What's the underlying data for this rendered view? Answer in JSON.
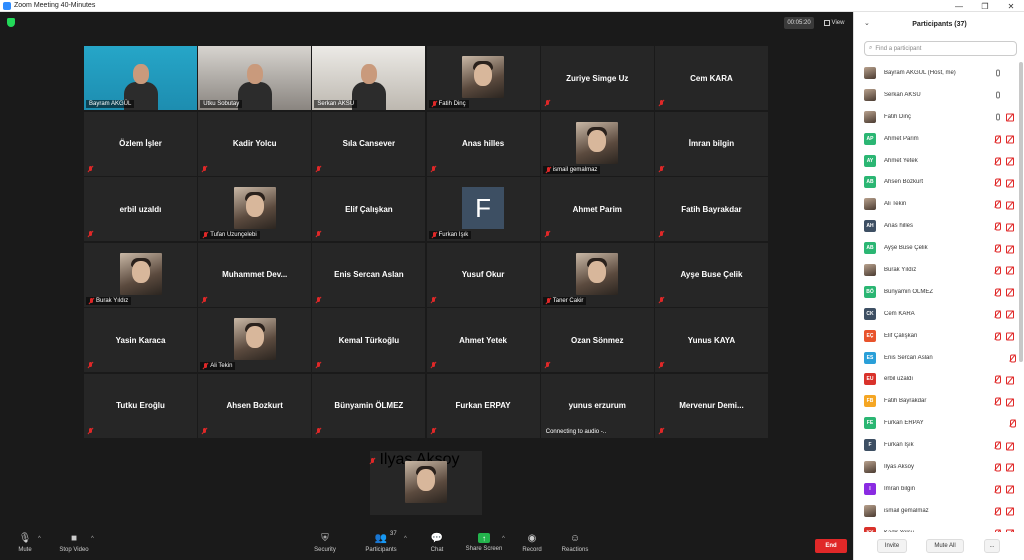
{
  "window": {
    "title": "Zoom Meeting 40-Minutes"
  },
  "meeting": {
    "timer": "00:05:20",
    "view_label": "View"
  },
  "tiles": [
    {
      "name": "Bayram AKGÜL",
      "kind": "video",
      "cam": "cam1",
      "active": true
    },
    {
      "name": "Utku Sobutay",
      "kind": "video",
      "cam": "cam2"
    },
    {
      "name": "Serkan AKSU",
      "kind": "video",
      "cam": "cam3"
    },
    {
      "name": "Fatih Dinç",
      "kind": "photo"
    },
    {
      "name": "Zuriye Simge Uz",
      "kind": "text"
    },
    {
      "name": "Cem KARA",
      "kind": "text"
    },
    {
      "name": "Özlem İşler",
      "kind": "text"
    },
    {
      "name": "Kadir Yolcu",
      "kind": "text"
    },
    {
      "name": "Sıla Cansever",
      "kind": "text"
    },
    {
      "name": "Anas hilles",
      "kind": "text"
    },
    {
      "name": "ismail gemalmaz",
      "kind": "photo"
    },
    {
      "name": "İmran bilgin",
      "kind": "text"
    },
    {
      "name": "erbil uzaldı",
      "kind": "text"
    },
    {
      "name": "Tufan Uzunçelebi",
      "kind": "photo"
    },
    {
      "name": "Elif Çalışkan",
      "kind": "text"
    },
    {
      "name": "Furkan Işık",
      "kind": "letter",
      "letter": "F"
    },
    {
      "name": "Ahmet Parim",
      "kind": "text"
    },
    {
      "name": "Fatih Bayrakdar",
      "kind": "text"
    },
    {
      "name": "Burak Yıldız",
      "kind": "photo"
    },
    {
      "name": "Muhammet  Dev...",
      "kind": "text"
    },
    {
      "name": "Enis Sercan Aslan",
      "kind": "text"
    },
    {
      "name": "Yusuf Okur",
      "kind": "text"
    },
    {
      "name": "Taner Cakir",
      "kind": "photo"
    },
    {
      "name": "Ayşe Buse Çelik",
      "kind": "text"
    },
    {
      "name": "Yasin Karaca",
      "kind": "text"
    },
    {
      "name": "Ali Tekin",
      "kind": "photo"
    },
    {
      "name": "Kemal Türkoğlu",
      "kind": "text"
    },
    {
      "name": "Ahmet Yetek",
      "kind": "text"
    },
    {
      "name": "Ozan Sönmez",
      "kind": "text"
    },
    {
      "name": "Yunus KAYA",
      "kind": "text"
    },
    {
      "name": "Tutku Eroğlu",
      "kind": "text"
    },
    {
      "name": "Ahsen Bozkurt",
      "kind": "text"
    },
    {
      "name": "Bünyamin ÖLMEZ",
      "kind": "text"
    },
    {
      "name": "Furkan ERPAY",
      "kind": "text"
    },
    {
      "name": "yunus erzurum",
      "kind": "text",
      "status": "Connecting to audio -.."
    },
    {
      "name": "Mervenur  Demi...",
      "kind": "text"
    }
  ],
  "solo_tile": {
    "name": "Ilyas Aksoy",
    "kind": "photo"
  },
  "toolbar": {
    "mute": "Mute",
    "stop_video": "Stop Video",
    "security": "Security",
    "participants": "Participants",
    "participants_count": "37",
    "chat": "Chat",
    "share_screen": "Share Screen",
    "record": "Record",
    "reactions": "Reactions",
    "end": "End"
  },
  "panel": {
    "title": "Participants (37)",
    "search_placeholder": "Find a participant",
    "invite": "Invite",
    "mute_all": "Mute All",
    "more": "...",
    "participants": [
      {
        "name": "Bayram AKGÜL (Host, me)",
        "avatar": "photo",
        "mic": "on",
        "cam": "on"
      },
      {
        "name": "Serkan AKSU",
        "avatar": "photo",
        "mic": "on",
        "cam": "on"
      },
      {
        "name": "Fatih Dinç",
        "avatar": "photo",
        "mic": "on",
        "cam": "off"
      },
      {
        "name": "Ahmet Parim",
        "initials": "AP",
        "color": "#2bb673",
        "mic": "off",
        "cam": "off"
      },
      {
        "name": "Ahmet Yetek",
        "initials": "AY",
        "color": "#2bb673",
        "mic": "off",
        "cam": "off"
      },
      {
        "name": "Ahsen Bozkurt",
        "initials": "AB",
        "color": "#2bb673",
        "mic": "off",
        "cam": "off"
      },
      {
        "name": "Ali Tekin",
        "avatar": "photo",
        "mic": "off",
        "cam": "off"
      },
      {
        "name": "Anas hilles",
        "initials": "AH",
        "color": "#3d4f63",
        "mic": "off",
        "cam": "off"
      },
      {
        "name": "Ayşe Buse Çelik",
        "initials": "AB",
        "color": "#2bb673",
        "mic": "off",
        "cam": "off"
      },
      {
        "name": "Burak Yıldız",
        "avatar": "photo",
        "mic": "off",
        "cam": "off"
      },
      {
        "name": "Bünyamin ÖLMEZ",
        "initials": "BÖ",
        "color": "#2bb673",
        "mic": "off",
        "cam": "off"
      },
      {
        "name": "Cem KARA",
        "initials": "CK",
        "color": "#3d4f63",
        "mic": "off",
        "cam": "off"
      },
      {
        "name": "Elif Çalışkan",
        "initials": "EÇ",
        "color": "#e8532c",
        "mic": "off",
        "cam": "off"
      },
      {
        "name": "Enis Sercan Aslan",
        "initials": "ES",
        "color": "#2a9fd8",
        "mic": "off",
        "cam": "none"
      },
      {
        "name": "erbil uzaldı",
        "initials": "EU",
        "color": "#d9322b",
        "mic": "off",
        "cam": "off"
      },
      {
        "name": "Fatih Bayrakdar",
        "initials": "FB",
        "color": "#f5a623",
        "mic": "off",
        "cam": "off"
      },
      {
        "name": "Furkan ERPAY",
        "initials": "FE",
        "color": "#2bb673",
        "mic": "off",
        "cam": "none"
      },
      {
        "name": "Furkan Işık",
        "initials": "F",
        "color": "#3d4f63",
        "mic": "off",
        "cam": "off"
      },
      {
        "name": "Ilyas Aksoy",
        "avatar": "photo",
        "mic": "off",
        "cam": "off"
      },
      {
        "name": "İmran bilgin",
        "initials": "I",
        "color": "#8a2be2",
        "mic": "off",
        "cam": "off"
      },
      {
        "name": "ismail gemalmaz",
        "avatar": "photo",
        "mic": "off",
        "cam": "off"
      },
      {
        "name": "Kadir Yolcu",
        "initials": "KY",
        "color": "#d9322b",
        "mic": "off",
        "cam": "off"
      }
    ]
  }
}
